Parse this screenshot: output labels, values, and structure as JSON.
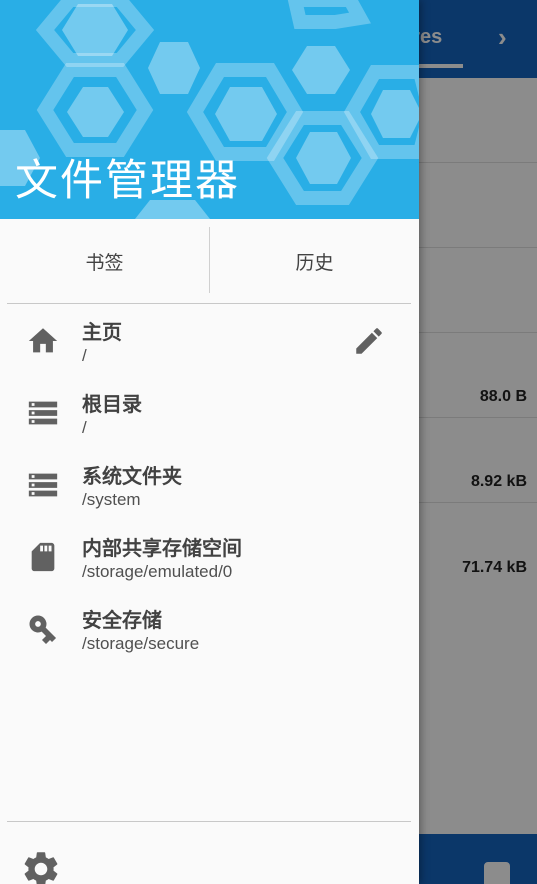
{
  "background": {
    "tab_label": "ures",
    "chevron": "›",
    "file_sizes": [
      "88.0 B",
      "8.92 kB",
      "71.74 kB"
    ]
  },
  "drawer": {
    "title": "文件管理器",
    "tabs": {
      "bookmarks": "书签",
      "history": "历史"
    },
    "items": [
      {
        "title": "主页",
        "path": "/",
        "icon": "home-icon"
      },
      {
        "title": "根目录",
        "path": "/",
        "icon": "storage-icon"
      },
      {
        "title": "系统文件夹",
        "path": "/system",
        "icon": "storage-icon"
      },
      {
        "title": "内部共享存储空间",
        "path": "/storage/emulated/0",
        "icon": "sd-card-icon"
      },
      {
        "title": "安全存储",
        "path": "/storage/secure",
        "icon": "key-icon"
      }
    ]
  },
  "colors": {
    "header": "#29aee6",
    "toolbar": "#1565c0",
    "icon": "#616161"
  }
}
